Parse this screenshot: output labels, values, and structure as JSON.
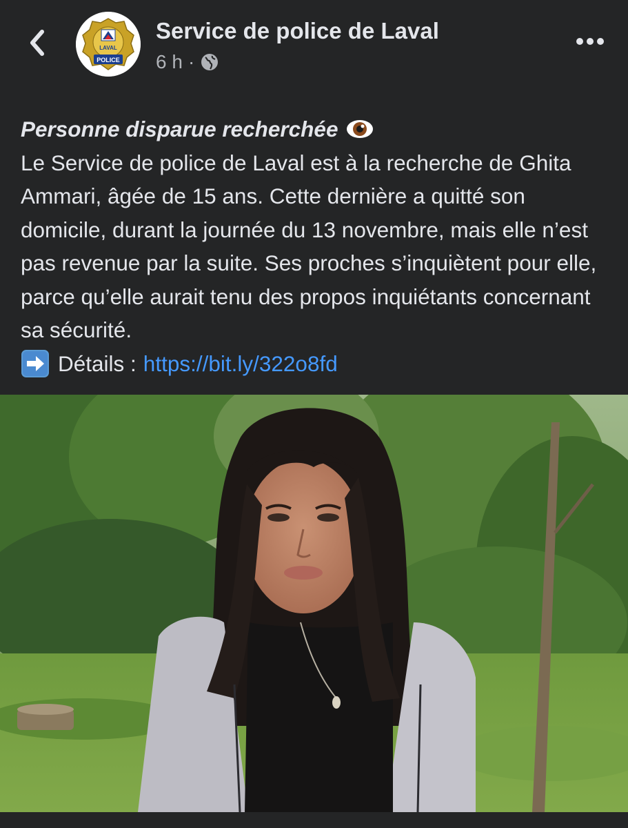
{
  "header": {
    "page_name": "Service de police de Laval",
    "time": "6 h",
    "separator": "·",
    "audience_icon": "globe-icon",
    "back_icon": "chevron-left-icon",
    "more_icon": "more-options-icon",
    "avatar": {
      "logo_text_top": "LAVAL",
      "logo_text_bottom": "POLICE"
    }
  },
  "post": {
    "title": "Personne disparue recherchée",
    "title_emoji": "eye-emoji",
    "text": "Le Service de police de Laval est à la recherche de Ghita Ammari, âgée de 15 ans. Cette dernière a quitté son domicile, durant la journée du 13 novembre, mais elle n’est pas revenue par la suite. Ses proches s’inquiètent pour elle, parce qu’elle aurait tenu des propos inquiétants concernant sa sécurité.",
    "details_label": "Détails :",
    "details_icon": "right-arrow-emoji",
    "details_link": "https://bit.ly/322o8fd"
  },
  "colors": {
    "background": "#242526",
    "text": "#e4e6eb",
    "secondary_text": "#b0b3b8",
    "link": "#4599ff"
  }
}
